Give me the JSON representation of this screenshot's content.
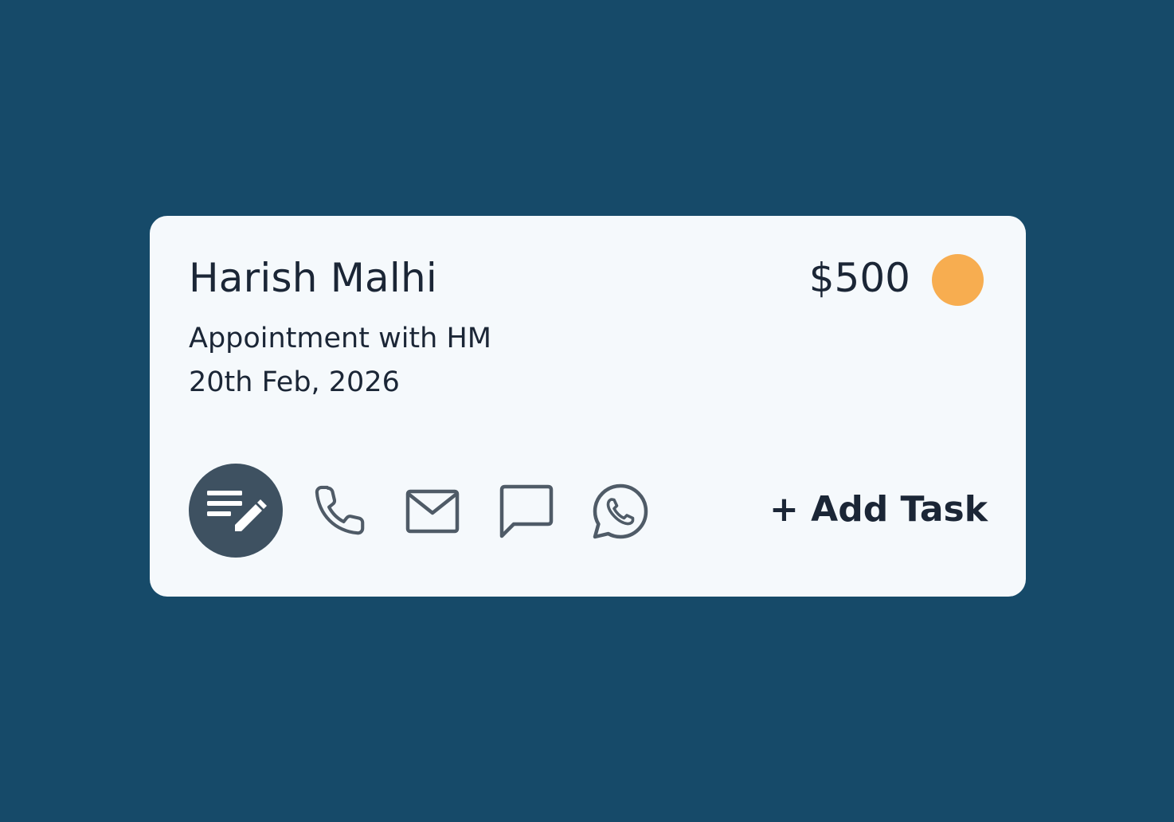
{
  "card": {
    "name": "Harish Malhi",
    "subtitle": "Appointment with HM",
    "date": "20th Feb, 2026",
    "amount": "$500",
    "status_color": "#f7ad50"
  },
  "actions": {
    "notes_icon": "notes-edit-icon",
    "call_icon": "phone-icon",
    "mail_icon": "mail-icon",
    "sms_icon": "chat-bubble-icon",
    "whatsapp_icon": "whatsapp-icon",
    "add_task_label": "+ Add Task"
  },
  "colors": {
    "background": "#164a69",
    "card": "#f5f9fc",
    "text": "#1b2636",
    "icon_stroke": "#4f5b67",
    "notes_button_bg": "#3e5161"
  }
}
